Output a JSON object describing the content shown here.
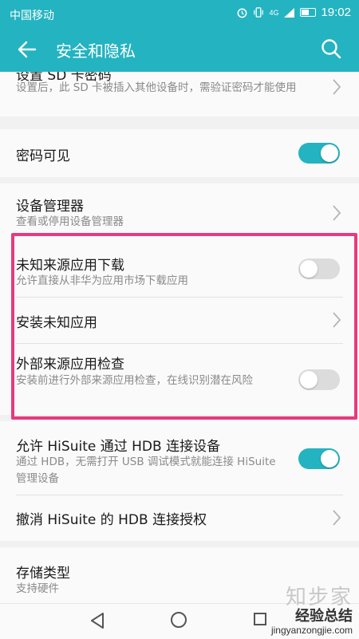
{
  "status_bar": {
    "carrier": "中国移动",
    "network": "4G",
    "time": "19:02"
  },
  "header": {
    "title": "安全和隐私"
  },
  "settings": {
    "sd_card": {
      "title": "设置 SD 卡密码",
      "subtitle": "设置后，此 SD 卡被插入其他设备时，需验证密码才能使用"
    },
    "password_visible": {
      "title": "密码可见",
      "enabled": true
    },
    "device_manager": {
      "title": "设备管理器",
      "subtitle": "查看或停用设备管理器"
    },
    "unknown_sources": {
      "title": "未知来源应用下载",
      "subtitle": "允许直接从非华为应用市场下载应用",
      "enabled": false
    },
    "install_unknown": {
      "title": "安装未知应用"
    },
    "external_check": {
      "title": "外部来源应用检查",
      "subtitle": "安装前进行外部来源应用检查，在线识别潜在风险",
      "enabled": false
    },
    "hisuite_hdb": {
      "title": "允许 HiSuite 通过 HDB 连接设备",
      "subtitle": "通过 HDB，无需打开 USB 调试模式就能连接 HiSuite 管理设备",
      "enabled": true
    },
    "revoke_hdb": {
      "title": "撤消 HiSuite 的 HDB 连接授权"
    },
    "storage_type": {
      "title": "存储类型",
      "subtitle": "支持硬件"
    }
  },
  "watermark": {
    "line1": "知步家",
    "line2": "经验总结",
    "line3": "jingyanzongjie.com"
  },
  "colors": {
    "accent": "#24b3c0",
    "highlight": "#e73a7f"
  }
}
